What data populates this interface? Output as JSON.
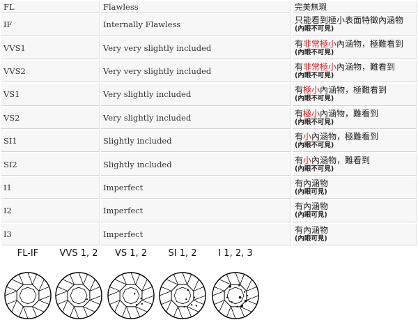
{
  "header": {
    "grade": "FL",
    "english": "Flawless",
    "chinese": "完美無瑕"
  },
  "rows": [
    {
      "grade": "IF",
      "english": "Internally Flawless",
      "cn_pre": "只能看到極小表面特徵內涵物",
      "cn_red": "",
      "cn_post": "",
      "cn_sub": "(內眼不可見)"
    },
    {
      "grade": "VVS1",
      "english": "Very very slightly included",
      "cn_pre": "有",
      "cn_red": "非常極小",
      "cn_post": "內涵物，極難看到",
      "cn_sub": "(內眼不可見)"
    },
    {
      "grade": "VVS2",
      "english": "Very very slightly included",
      "cn_pre": "有",
      "cn_red": "非常極小",
      "cn_post": "內涵物，難看到",
      "cn_sub": "(內眼不可見)"
    },
    {
      "grade": "VS1",
      "english": "Very slightly included",
      "cn_pre": "有",
      "cn_red": "極小",
      "cn_post": "內涵物，極難看到",
      "cn_sub": "(內眼不可見)"
    },
    {
      "grade": "VS2",
      "english": "Very slightly included",
      "cn_pre": "有",
      "cn_red": "極小",
      "cn_post": "內涵物，難看到",
      "cn_sub": "(內眼不可見)"
    },
    {
      "grade": "SI1",
      "english": "Slightly included",
      "cn_pre": "有",
      "cn_red": "小",
      "cn_post": "內涵物，極難看到",
      "cn_sub": "(內眼不可見)"
    },
    {
      "grade": "SI2",
      "english": "Slightly included",
      "cn_pre": "有",
      "cn_red": "小",
      "cn_post": "內涵物，難看到",
      "cn_sub": "(內眼不可見)"
    },
    {
      "grade": "I1",
      "english": "Imperfect",
      "cn_pre": "有內涵物",
      "cn_red": "",
      "cn_post": "",
      "cn_sub": "(內眼可見)"
    },
    {
      "grade": "I2",
      "english": "Imperfect",
      "cn_pre": "有內涵物",
      "cn_red": "",
      "cn_post": "",
      "cn_sub": "(內眼可見)"
    },
    {
      "grade": "I3",
      "english": "Imperfect",
      "cn_pre": "有內涵物",
      "cn_red": "",
      "cn_post": "",
      "cn_sub": "(內眼可見)"
    }
  ],
  "diagrams": [
    {
      "label": "FL-IF",
      "inclusion_level": 0
    },
    {
      "label": "VVS 1, 2",
      "inclusion_level": 1
    },
    {
      "label": "VS 1, 2",
      "inclusion_level": 2
    },
    {
      "label": "SI 1, 2",
      "inclusion_level": 3
    },
    {
      "label": "I 1, 2, 3",
      "inclusion_level": 4
    }
  ],
  "colors": {
    "cell_bg": "#f7f7f7",
    "highlight_red": "#d41e1e",
    "diagram_stroke": "#000000"
  }
}
